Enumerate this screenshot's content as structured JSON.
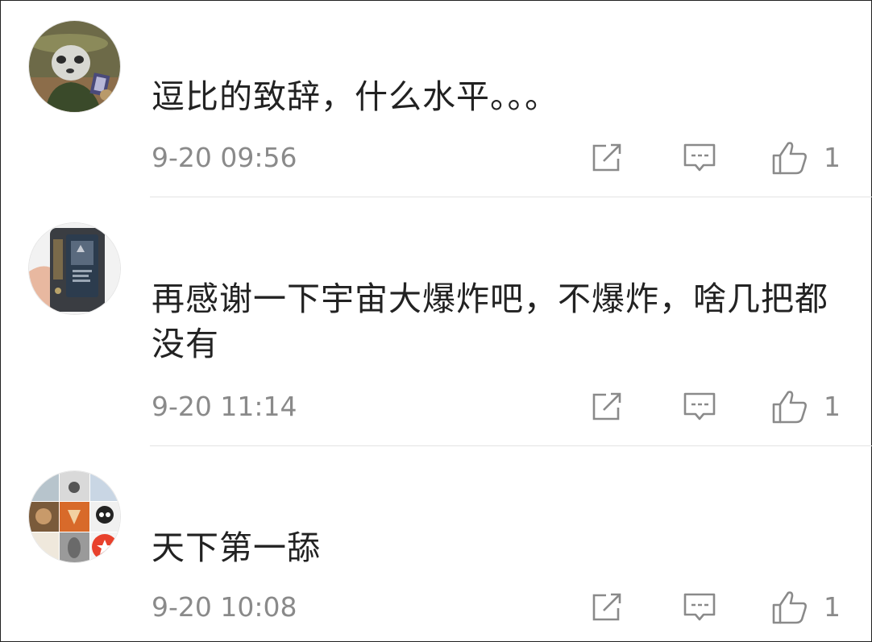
{
  "comments": [
    {
      "avatar": "panda-warrior-avatar",
      "text": "逗比的致辞，什么水平。。。",
      "time": "9-20 09:56",
      "likes": "1"
    },
    {
      "avatar": "phone-battery-avatar",
      "text": "再感谢一下宇宙大爆炸吧，不爆炸，啥几把都没有",
      "time": "9-20 11:14",
      "likes": "1"
    },
    {
      "avatar": "photo-grid-avatar",
      "text": "天下第一舔",
      "time": "9-20 10:08",
      "likes": "1"
    }
  ],
  "icons": {
    "share": "share-icon",
    "reply": "reply-icon",
    "like": "thumbs-up-icon"
  },
  "colors": {
    "text": "#222222",
    "meta": "#8a8a8a",
    "divider": "#e3e3e3",
    "badge": "#e8412c"
  }
}
